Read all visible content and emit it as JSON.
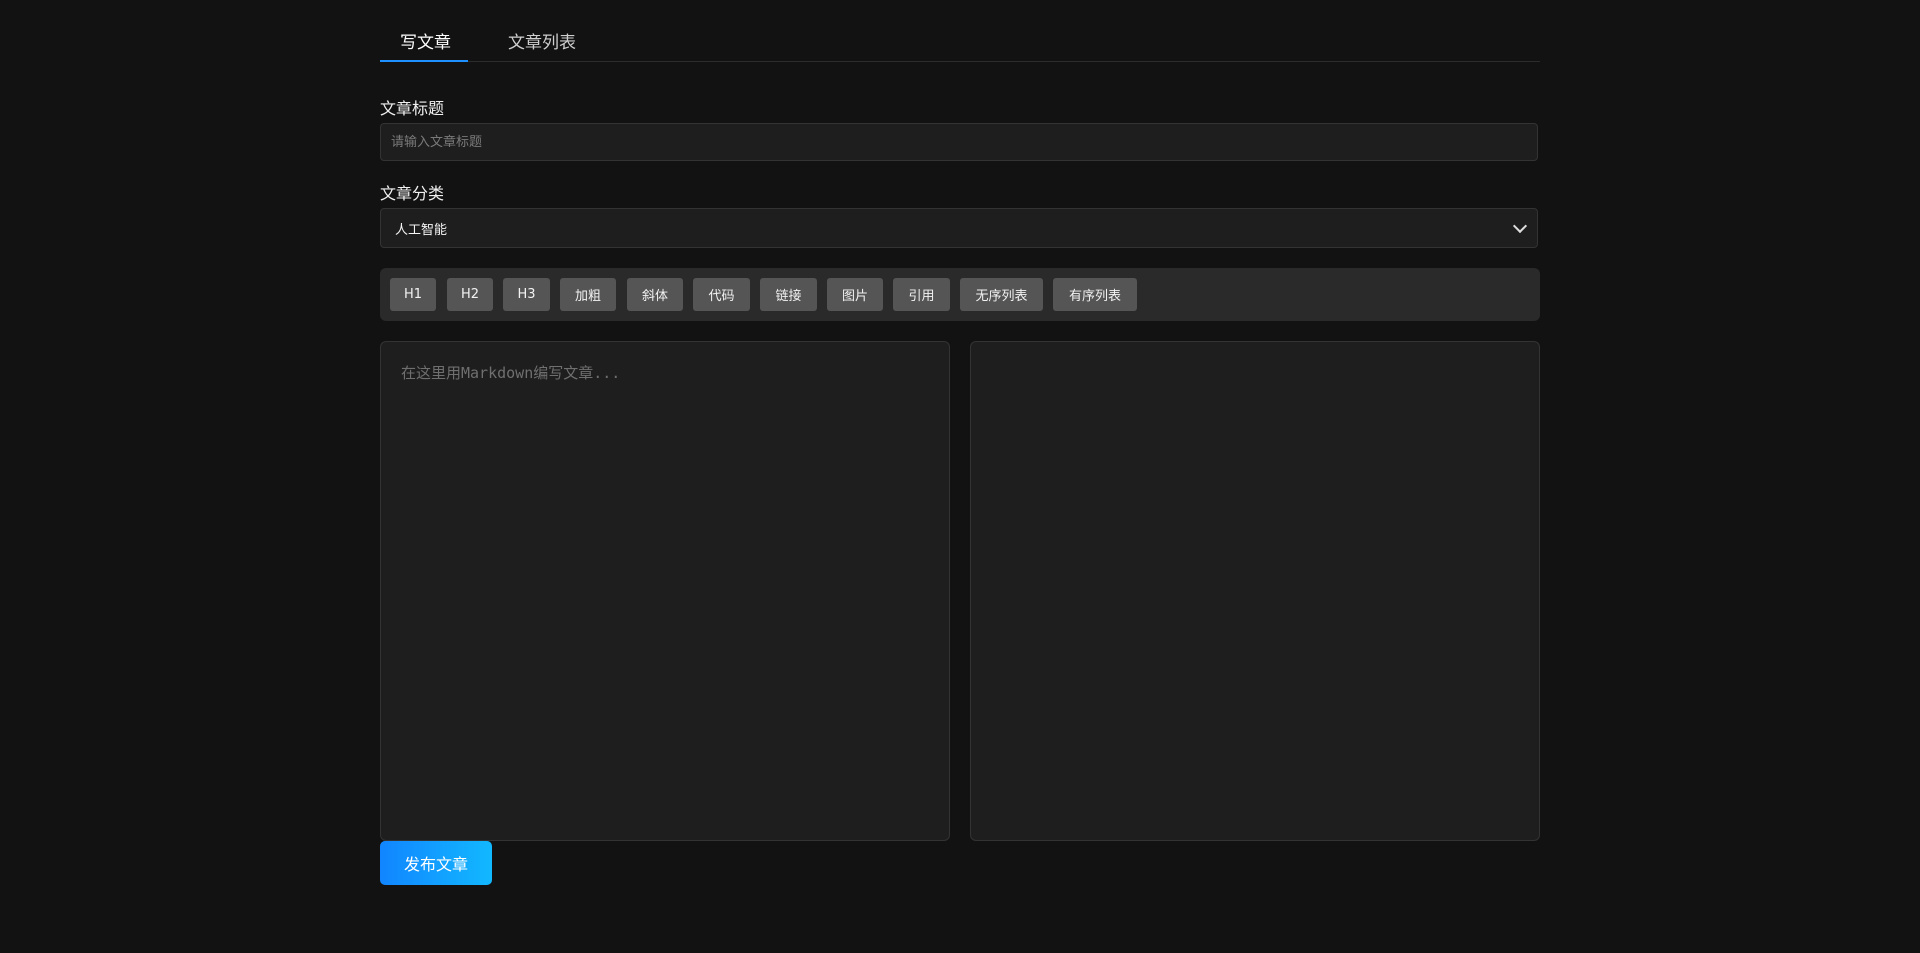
{
  "tabs": [
    {
      "label": "写文章",
      "active": true
    },
    {
      "label": "文章列表",
      "active": false
    }
  ],
  "form": {
    "title_label": "文章标题",
    "title_placeholder": "请输入文章标题",
    "title_value": "",
    "category_label": "文章分类",
    "category_selected": "人工智能"
  },
  "toolbar": {
    "buttons": [
      "H1",
      "H2",
      "H3",
      "加粗",
      "斜体",
      "代码",
      "链接",
      "图片",
      "引用",
      "无序列表",
      "有序列表"
    ]
  },
  "editor": {
    "placeholder": "在这里用Markdown编写文章...",
    "value": ""
  },
  "actions": {
    "publish_label": "发布文章"
  },
  "colors": {
    "accent": "#1e90ff",
    "background": "#121212",
    "panel": "#1e1e1e",
    "toolbar": "#2a2a2a",
    "tool_button": "#555555"
  }
}
